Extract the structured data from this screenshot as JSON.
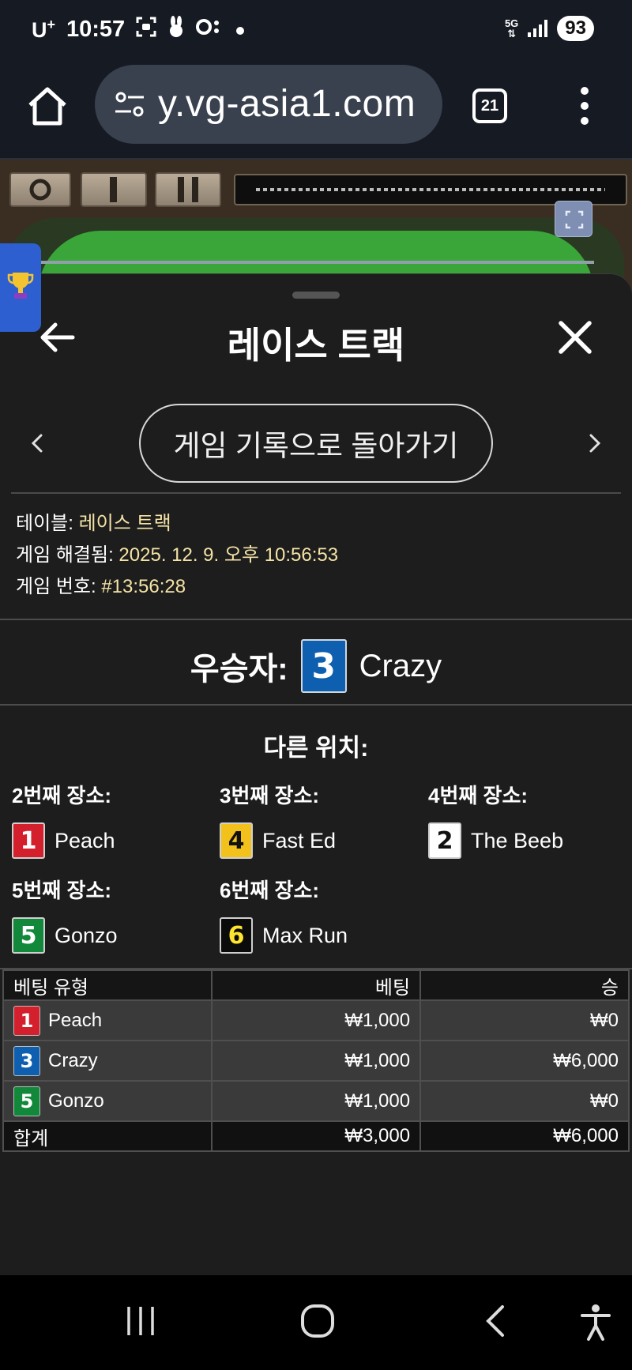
{
  "status_bar": {
    "carrier": "U",
    "carrier_sup": "+",
    "time": "10:57",
    "network": "5G",
    "battery": "93"
  },
  "browser": {
    "url": "y.vg-asia1.com",
    "tab_count": "21"
  },
  "panel": {
    "title": "레이스 트랙",
    "back_to_history": "게임 기록으로 돌아가기",
    "info": {
      "table_label": "테이블:",
      "table_value": "레이스 트랙",
      "resolved_label": "게임 해결됨:",
      "resolved_value": "2025. 12. 9. 오후 10:56:53",
      "game_no_label": "게임 번호:",
      "game_no_value": "#13:56:28"
    },
    "winner": {
      "label": "우승자:",
      "number": "3",
      "name": "Crazy",
      "color": "#0f5fb0"
    },
    "other_positions_title": "다른 위치:",
    "positions": [
      {
        "label": "2번째 장소:",
        "number": "1",
        "name": "Peach",
        "color": "#d4202c"
      },
      {
        "label": "3번째 장소:",
        "number": "4",
        "name": "Fast Ed",
        "color": "#f2c11b"
      },
      {
        "label": "4번째 장소:",
        "number": "2",
        "name": "The Beeb",
        "color": "#ffffff"
      },
      {
        "label": "5번째 장소:",
        "number": "5",
        "name": "Gonzo",
        "color": "#12883a"
      },
      {
        "label": "6번째 장소:",
        "number": "6",
        "name": "Max Run",
        "color": "#0b0b0b"
      }
    ],
    "table": {
      "headers": [
        "베팅 유형",
        "베팅",
        "승"
      ],
      "rows": [
        {
          "number": "1",
          "name": "Peach",
          "bet": "₩1,000",
          "win": "₩0"
        },
        {
          "number": "3",
          "name": "Crazy",
          "bet": "₩1,000",
          "win": "₩6,000"
        },
        {
          "number": "5",
          "name": "Gonzo",
          "bet": "₩1,000",
          "win": "₩0"
        }
      ],
      "total": {
        "label": "합계",
        "bet": "₩3,000",
        "win": "₩6,000"
      }
    }
  }
}
